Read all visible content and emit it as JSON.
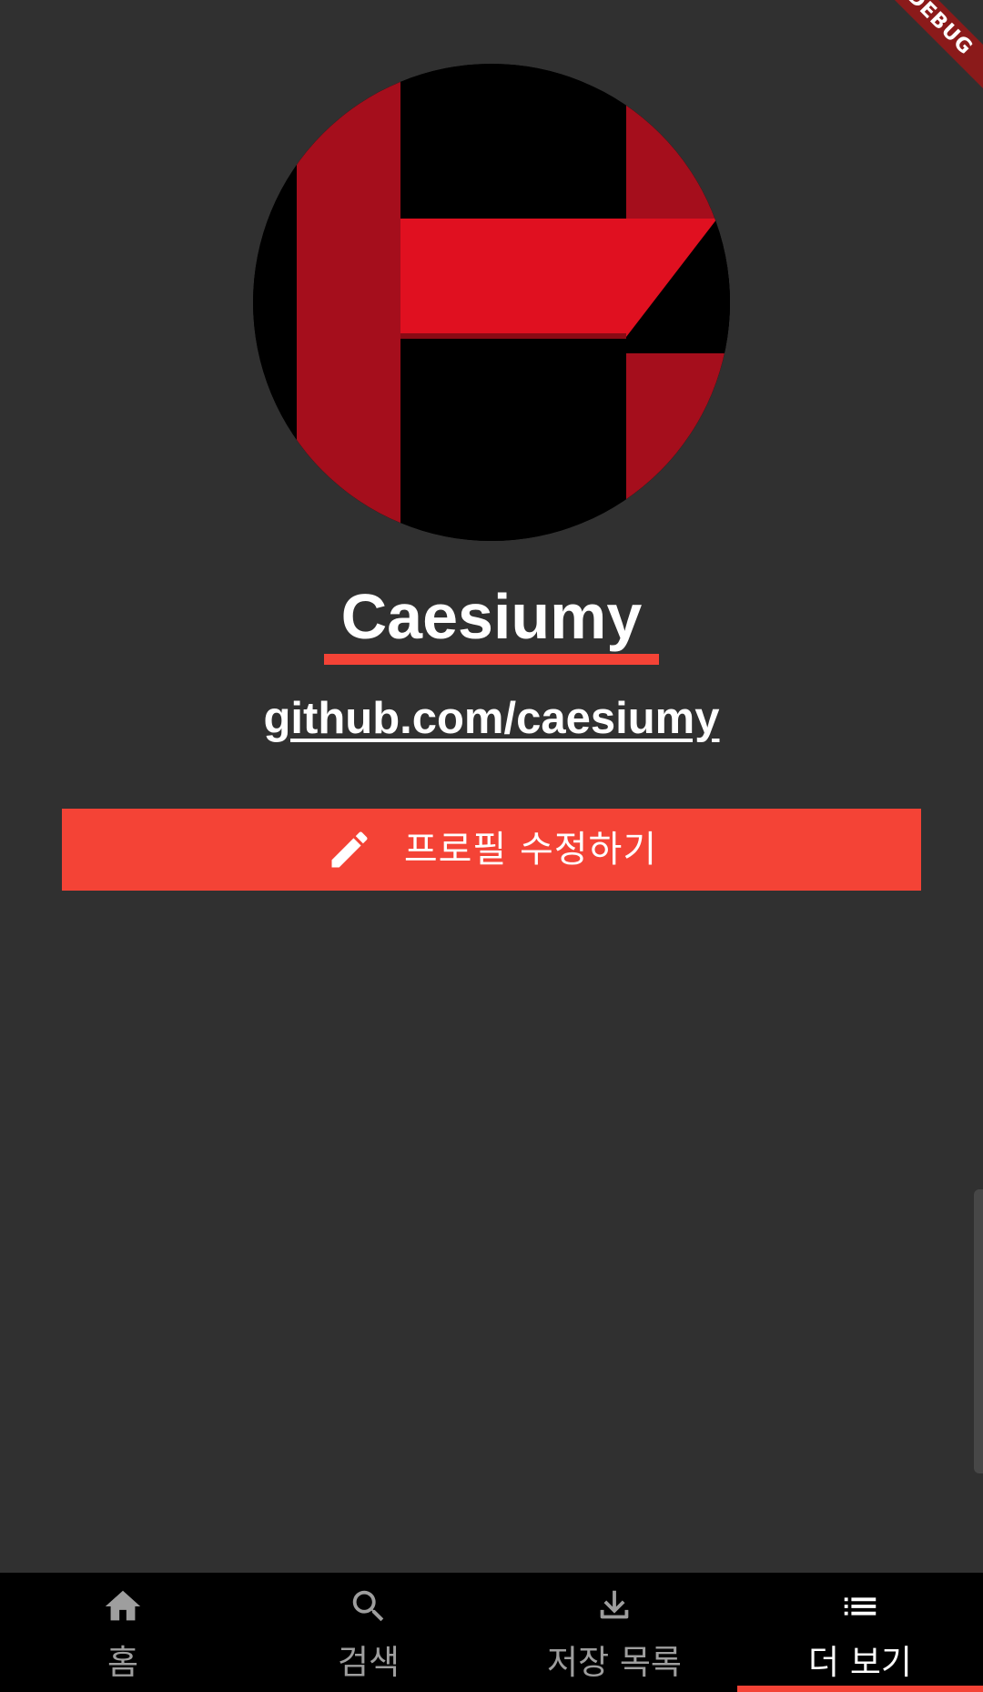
{
  "debug_banner": "DEBUG",
  "profile": {
    "name": "Caesiumy",
    "link": "github.com/caesiumy",
    "edit_button_label": "프로필 수정하기",
    "edit_icon": "pencil-icon"
  },
  "bottom_nav": {
    "items": [
      {
        "label": "홈",
        "icon": "home-icon",
        "active": false
      },
      {
        "label": "검색",
        "icon": "search-icon",
        "active": false
      },
      {
        "label": "저장 목록",
        "icon": "download-icon",
        "active": false
      },
      {
        "label": "더 보기",
        "icon": "list-icon",
        "active": true
      }
    ]
  },
  "colors": {
    "background": "#303030",
    "accent": "#f44336",
    "nav_background": "#000000",
    "inactive_nav": "#9e9e9e",
    "avatar_red": "#e01020",
    "avatar_dark_red": "#a50e1c"
  }
}
